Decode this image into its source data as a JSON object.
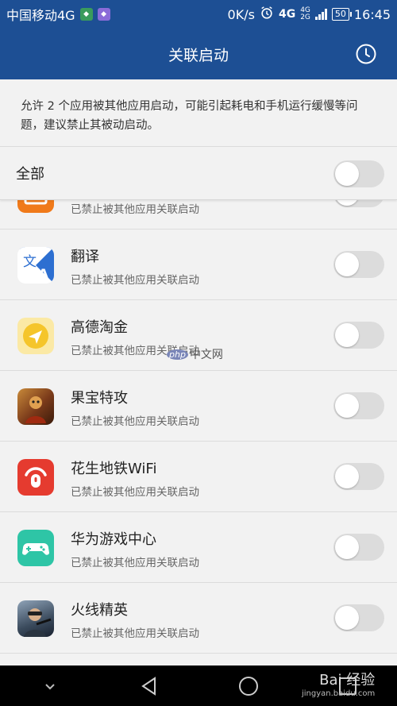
{
  "status_bar": {
    "carrier": "中国移动4G",
    "speed": "0K/s",
    "network_4g": "4G",
    "network_small_top": "4G",
    "network_small_bottom": "2G",
    "battery": "50",
    "time": "16:45"
  },
  "header": {
    "title": "关联启动"
  },
  "description": "允许 2 个应用被其他应用启动，可能引起耗电和手机运行缓慢等问题，建议禁止其被动启动。",
  "all_row": {
    "label": "全部",
    "enabled": false
  },
  "apps": [
    {
      "name": "",
      "status": "已禁止被其他应用关联启动",
      "icon": "orange-app-icon",
      "color": "#f07a1a",
      "enabled": false
    },
    {
      "name": "翻译",
      "status": "已禁止被其他应用关联启动",
      "icon": "translate-icon",
      "color": "#2d6fd1",
      "enabled": false
    },
    {
      "name": "高德淘金",
      "status": "已禁止被其他应用关联启动",
      "icon": "gaode-taojin-icon",
      "color": "#f5c52b",
      "enabled": false
    },
    {
      "name": "果宝特攻",
      "status": "已禁止被其他应用关联启动",
      "icon": "guobao-tegong-icon",
      "color": "#7a3a1a",
      "enabled": false
    },
    {
      "name": "花生地铁WiFi",
      "status": "已禁止被其他应用关联启动",
      "icon": "peanut-wifi-icon",
      "color": "#e53b2f",
      "enabled": false
    },
    {
      "name": "华为游戏中心",
      "status": "已禁止被其他应用关联启动",
      "icon": "gamepad-icon",
      "color": "#2ec5a6",
      "enabled": false
    },
    {
      "name": "火线精英",
      "status": "已禁止被其他应用关联启动",
      "icon": "huoxian-jingying-icon",
      "color": "#5a6b80",
      "enabled": false
    }
  ],
  "watermarks": {
    "php_logo": "php",
    "php_text": "中文网",
    "baidu": "Bai 经验",
    "baidu_url": "jingyan.baidu.com"
  },
  "colors": {
    "header": "#1d4f94",
    "background": "#f2f2f2",
    "toggle_off": "#dcdcdc"
  }
}
